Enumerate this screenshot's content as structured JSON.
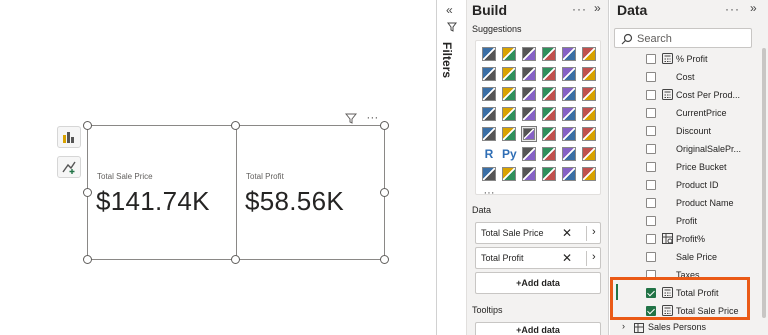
{
  "canvas": {
    "cards": [
      {
        "label": "Total Sale Price",
        "value": "$141.74K"
      },
      {
        "label": "Total Profit",
        "value": "$58.56K"
      }
    ],
    "visual_tools": {
      "filter_icon": "filter-icon",
      "more": "···"
    }
  },
  "filters": {
    "label": "Filters",
    "collapse": "«"
  },
  "build": {
    "title": "Build",
    "more": "···",
    "collapse": "»",
    "suggestions_label": "Suggestions",
    "visuals": [
      "stacked-bar",
      "clustered-bar",
      "100-bar",
      "stacked-column",
      "clustered-column",
      "100-column",
      "line",
      "area",
      "stacked-area",
      "100-area",
      "line-column",
      "line-clustered",
      "ribbon",
      "waterfall",
      "funnel",
      "scatter",
      "pie",
      "donut",
      "treemap",
      "map",
      "filled-map",
      "shape-map",
      "azure-map",
      "gauge",
      "card",
      "multi-row-card",
      "kpi",
      "slicer",
      "table",
      "matrix",
      "r-visual",
      "python-visual",
      "key-influencers",
      "decomposition-tree",
      "qa",
      "smart-narrative",
      "trophy",
      "paginated",
      "power-apps",
      "arcgis",
      "diamond-visual",
      "get-more",
      "more"
    ],
    "r_label": "R",
    "py_label": "Py",
    "data_label": "Data",
    "wells": [
      {
        "label": "Total Sale Price",
        "remove": "✕",
        "expand": "›"
      },
      {
        "label": "Total Profit",
        "remove": "✕",
        "expand": "›"
      }
    ],
    "add_data": "+Add data",
    "tooltips_label": "Tooltips",
    "tooltips_add": "+Add data"
  },
  "data": {
    "title": "Data",
    "more": "···",
    "collapse": "»",
    "search_placeholder": "Search",
    "fields": [
      {
        "name": "% Profit",
        "icon": "calculator-icon",
        "checked": false
      },
      {
        "name": "Cost",
        "icon": "",
        "checked": false
      },
      {
        "name": "Cost Per Prod...",
        "icon": "calculator-icon",
        "checked": false
      },
      {
        "name": "CurrentPrice",
        "icon": "",
        "checked": false
      },
      {
        "name": "Discount",
        "icon": "",
        "checked": false
      },
      {
        "name": "OriginalSalePr...",
        "icon": "",
        "checked": false
      },
      {
        "name": "Price Bucket",
        "icon": "",
        "checked": false
      },
      {
        "name": "Product ID",
        "icon": "",
        "checked": false
      },
      {
        "name": "Product Name",
        "icon": "",
        "checked": false
      },
      {
        "name": "Profit",
        "icon": "",
        "checked": false
      },
      {
        "name": "Profit%",
        "icon": "calc-column-icon",
        "checked": false
      },
      {
        "name": "Sale Price",
        "icon": "",
        "checked": false
      },
      {
        "name": "Taxes",
        "icon": "",
        "checked": false
      },
      {
        "name": "Total Profit",
        "icon": "calculator-icon",
        "checked": true
      },
      {
        "name": "Total Sale Price",
        "icon": "calculator-icon",
        "checked": true
      }
    ],
    "group": {
      "name": "Sales Persons",
      "expander": "›",
      "icon": "table-icon"
    }
  },
  "colors": {
    "accent": "#217346",
    "highlight": "#ea5a16"
  }
}
